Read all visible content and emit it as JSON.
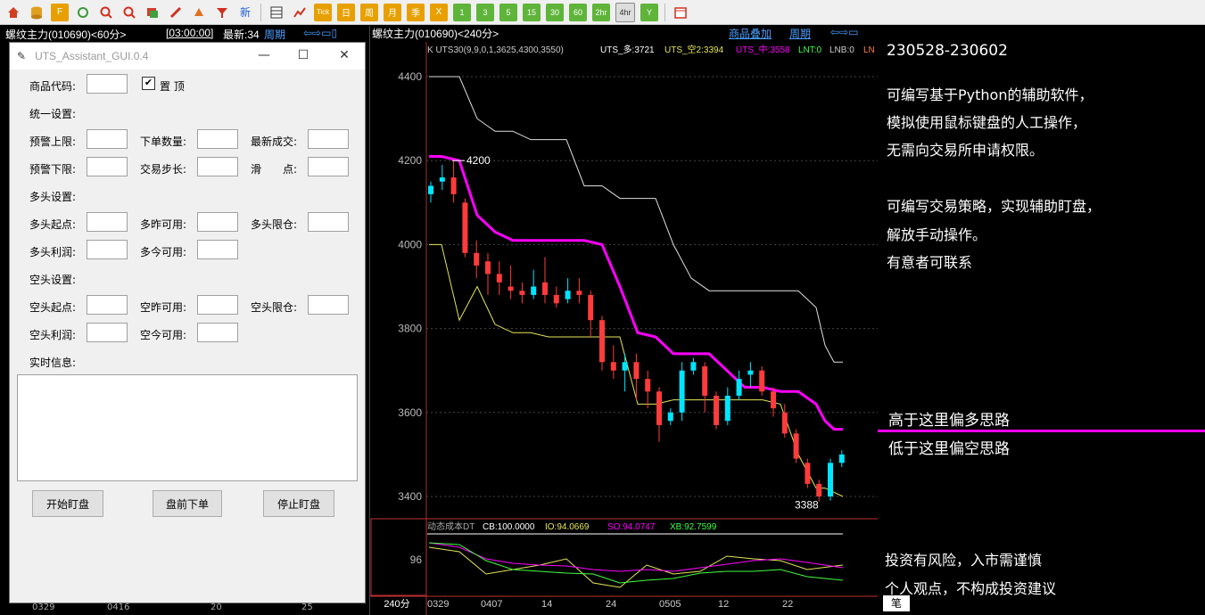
{
  "toolbar": {
    "items": [
      "home-icon",
      "db-icon",
      "fin-icon",
      "refresh-icon",
      "zoom-in-icon",
      "zoom-out-icon",
      "window-icon",
      "pen-icon",
      "lamp-icon",
      "filter-icon"
    ],
    "xin": "新",
    "periods": [
      "Tick",
      "日",
      "周",
      "月",
      "季",
      "X",
      "1",
      "3",
      "5",
      "15",
      "30",
      "60",
      "2hr",
      "4hr",
      "Y"
    ],
    "selected_period": "4hr"
  },
  "left_chart": {
    "title": "螺纹主力(010690)<60分>",
    "time": "[03:00:00]",
    "latest": "最新:34",
    "period_link": "周期",
    "axis_labels": [
      "0329",
      "0416",
      "20",
      "25"
    ]
  },
  "dialog": {
    "title": "UTS_Assistant_GUI.0.4",
    "code_label": "商品代码:",
    "pin_label": "置 顶",
    "pin_checked": true,
    "unified_label": "统一设置:",
    "warn_upper": "预警上限:",
    "order_qty": "下单数量:",
    "latest_deal": "最新成交:",
    "warn_lower": "预警下限:",
    "trade_step": "交易步长:",
    "slippage": "滑　　点:",
    "long_settings": "多头设置:",
    "long_start": "多头起点:",
    "long_yesterday": "多昨可用:",
    "long_limit": "多头限仓:",
    "long_profit": "多头利润:",
    "long_today": "多今可用:",
    "short_settings": "空头设置:",
    "short_start": "空头起点:",
    "short_yesterday": "空昨可用:",
    "short_limit": "空头限仓:",
    "short_profit": "空头利润:",
    "short_today": "空今可用:",
    "realtime_info": "实时信息:",
    "start_button": "开始盯盘",
    "preorder_button": "盘前下单",
    "stop_button": "停止盯盘"
  },
  "main_chart": {
    "title": "螺纹主力(010690)<240分>",
    "overlay_link": "商品叠加",
    "period_link": "周期",
    "indicator_line": "K  UTS30(9,9,0,1,3625,4300,3550)",
    "uts_long": "UTS_多:3721",
    "uts_short": "UTS_空2:3394",
    "uts_mid": "UTS_中:3558",
    "lnt": "LNT:0",
    "lnb": "LNB:0",
    "lnx": "LN",
    "y_labels": [
      "4400",
      "4200",
      "4000",
      "3800",
      "3600",
      "3400"
    ],
    "y_values": [
      4400,
      4200,
      4000,
      3800,
      3600,
      3400
    ],
    "high_marker": "4200",
    "low_marker": "3388",
    "sub_title": "动态成本DT",
    "sub_cb": "CB:100.0000",
    "sub_io": "IO:94.0669",
    "sub_so": "SO:94.0747",
    "sub_xb": "XB:92.7599",
    "sub_ylabel": "96",
    "period_tag": "240分",
    "x_labels": [
      "0329",
      "0407",
      "14",
      "24",
      "0505",
      "12",
      "22"
    ],
    "colors": {
      "up": "#ff3b3b",
      "down": "#00e5ff",
      "mid": "#ff00ff",
      "upper": "#e0e0e0",
      "lower": "#e6e65a"
    }
  },
  "right_panel": {
    "date_range": "230528-230602",
    "lines1": [
      "可编写基于Python的辅助软件，",
      "模拟使用鼠标键盘的人工操作，",
      "无需向交易所申请权限。"
    ],
    "lines2": [
      "可编写交易策略，实现辅助盯盘，",
      "解放手动操作。",
      "有意者可联系"
    ],
    "above_text": "高于这里偏多思路",
    "below_text": "低于这里偏空思路",
    "risk1": "投资有风险，入市需谨慎",
    "risk2": "个人观点，不构成投资建议",
    "tab": "笔"
  }
}
